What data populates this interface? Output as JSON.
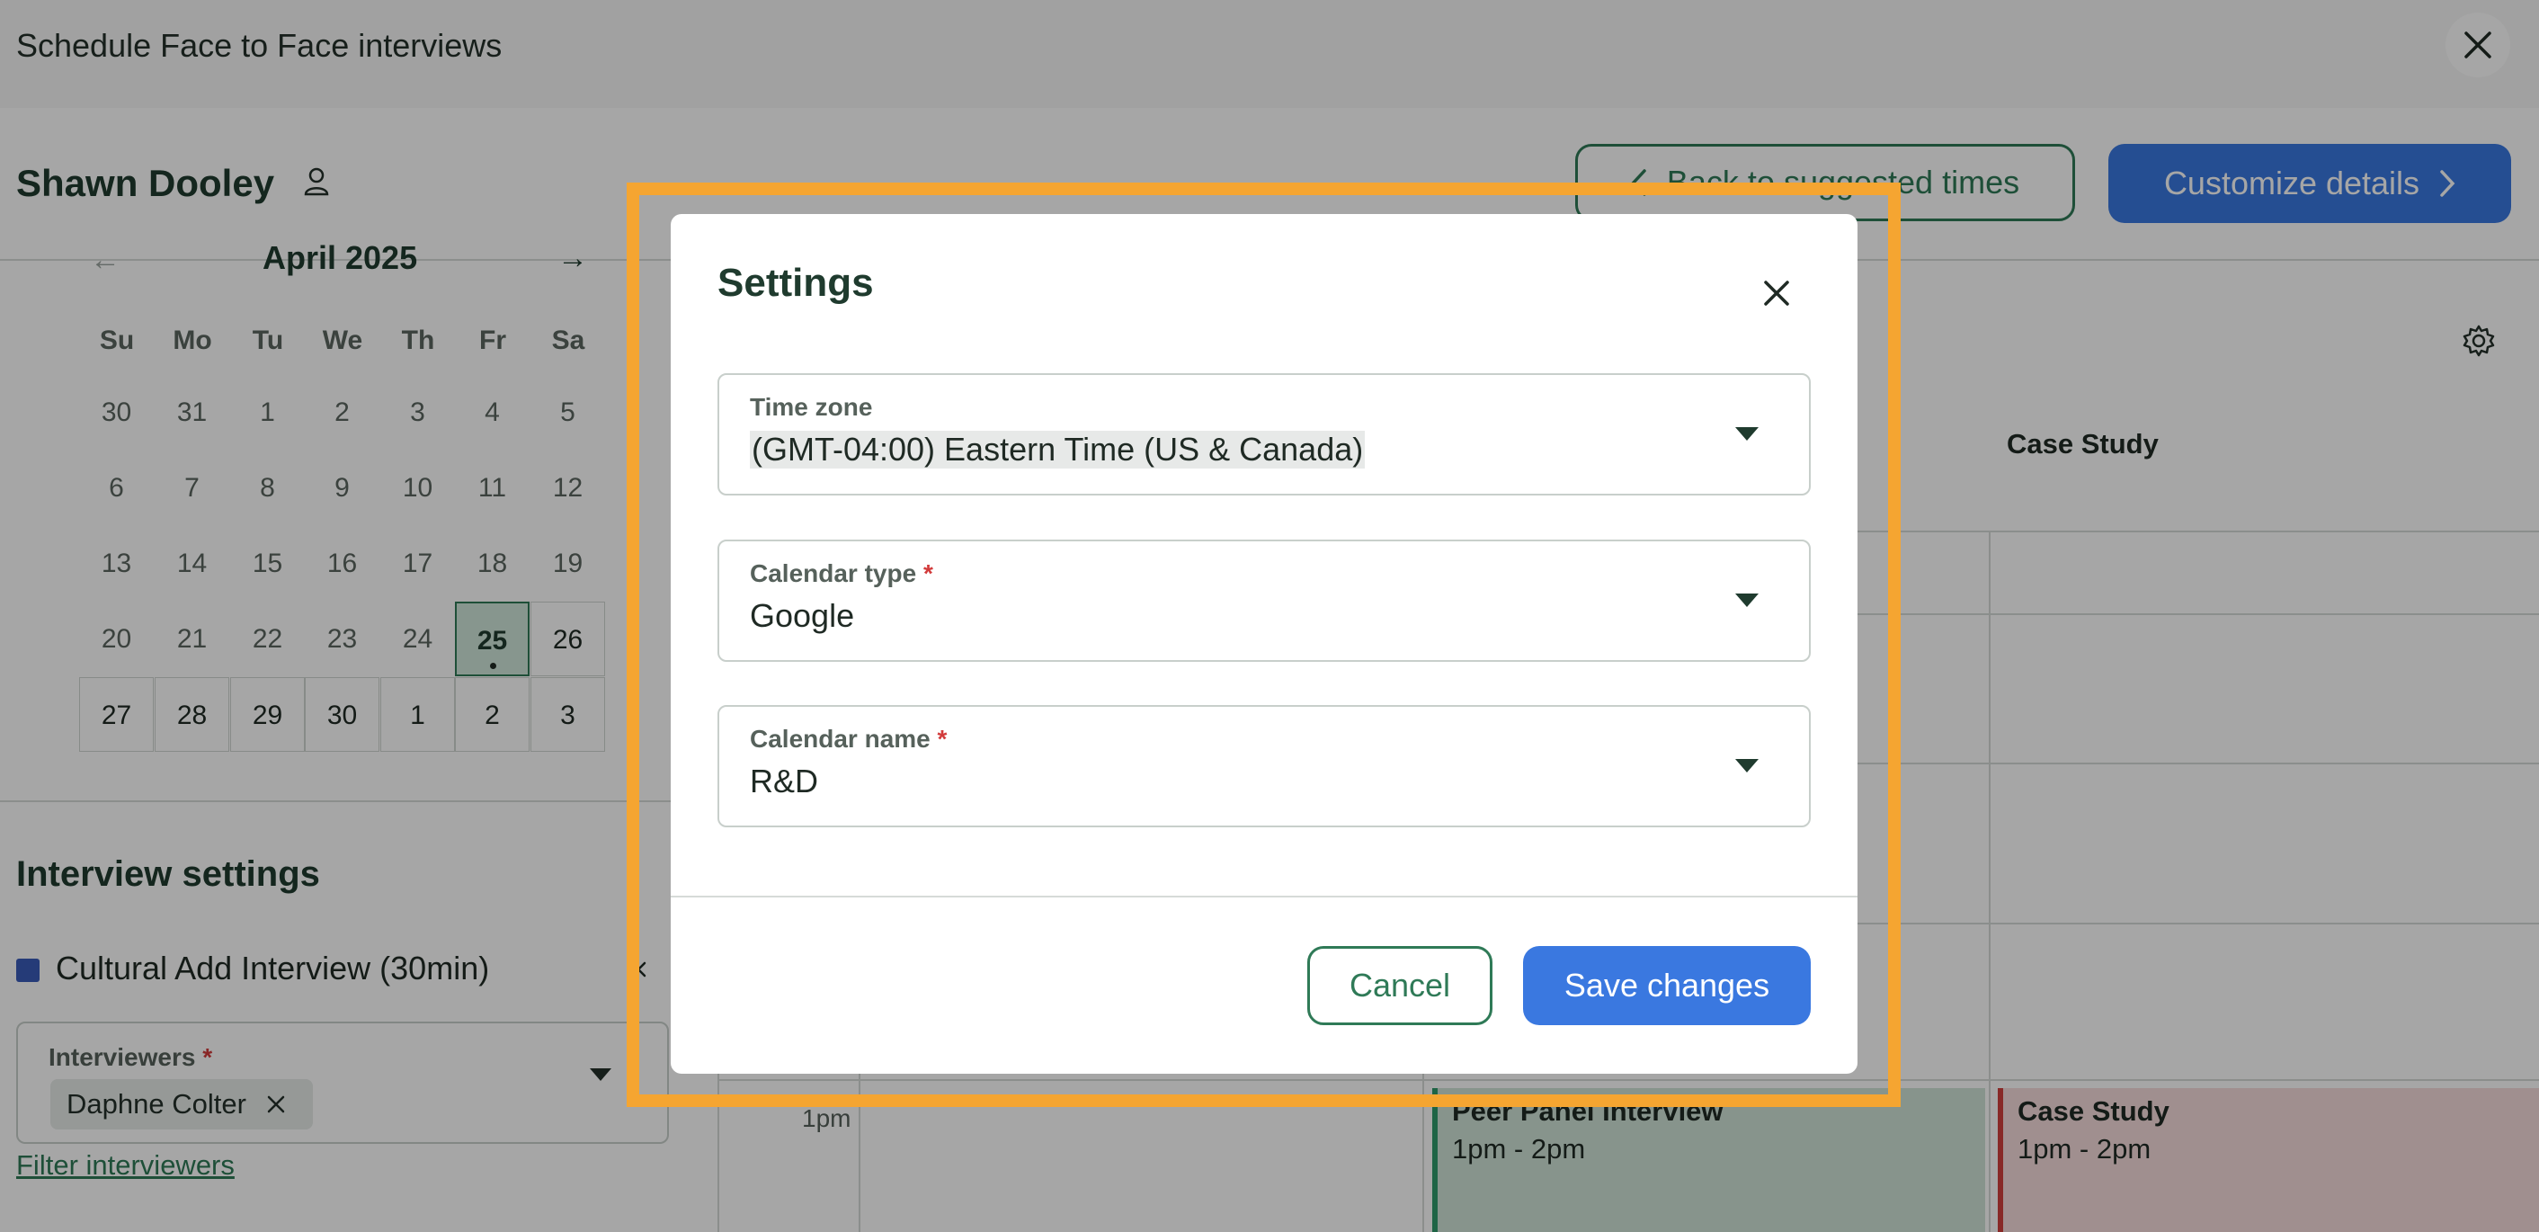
{
  "header": {
    "title": "Schedule Face to Face interviews",
    "close_icon": "close-icon"
  },
  "candidate": {
    "name": "Shawn Dooley",
    "icon": "person-icon"
  },
  "actions": {
    "back_label": "Back to suggested times",
    "customize_label": "Customize details"
  },
  "calendar": {
    "month": "April 2025",
    "weekdays": [
      "Su",
      "Mo",
      "Tu",
      "We",
      "Th",
      "Fr",
      "Sa"
    ],
    "weeks": [
      [
        "30",
        "31",
        "1",
        "2",
        "3",
        "4",
        "5"
      ],
      [
        "6",
        "7",
        "8",
        "9",
        "10",
        "11",
        "12"
      ],
      [
        "13",
        "14",
        "15",
        "16",
        "17",
        "18",
        "19"
      ],
      [
        "20",
        "21",
        "22",
        "23",
        "24",
        "25",
        "26"
      ],
      [
        "27",
        "28",
        "29",
        "30",
        "1",
        "2",
        "3"
      ]
    ],
    "selected": "25"
  },
  "interview_settings": {
    "title": "Interview settings",
    "item": "Cultural Add Interview (30min)",
    "interviewers_label": "Interviewers",
    "required_mark": "*",
    "interviewer_chip": "Daphne Colter",
    "filter_link": "Filter interviewers"
  },
  "schedule": {
    "column_header": "Case Study",
    "time_label": "1pm",
    "events": [
      {
        "title": "Peer Panel Interview",
        "time": "1pm - 2pm",
        "color": "#2f9a6a"
      },
      {
        "title": "Case Study",
        "time": "1pm - 2pm",
        "color": "#d2403c"
      }
    ]
  },
  "modal": {
    "title": "Settings",
    "time_zone": {
      "label": "Time zone",
      "value": "(GMT-04:00) Eastern Time (US & Canada)"
    },
    "calendar_type": {
      "label": "Calendar type",
      "required": "*",
      "value": "Google"
    },
    "calendar_name": {
      "label": "Calendar name",
      "required": "*",
      "value": "R&D"
    },
    "cancel_label": "Cancel",
    "save_label": "Save changes"
  },
  "colors": {
    "accent_green": "#2f7a57",
    "primary_blue": "#3a78e0",
    "highlight_orange": "#f5a531",
    "required_red": "#d23b3b"
  }
}
